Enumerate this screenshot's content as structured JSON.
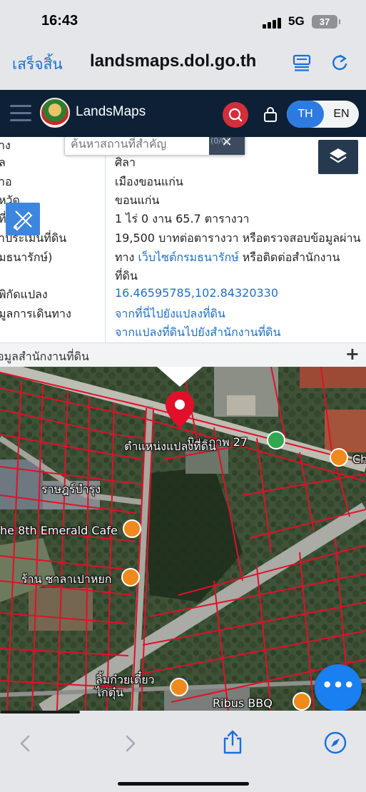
{
  "status_bar": {
    "time": "16:43",
    "network": "5G",
    "battery": "37"
  },
  "browser": {
    "done_label": "เสร็จสิ้น",
    "url": "landsmaps.dol.go.th"
  },
  "header": {
    "brand": "LandsMaps",
    "lang_th": "TH",
    "lang_en": "EN"
  },
  "search": {
    "placeholder": "ค้นหาสถานที่สำคัญ",
    "suffix": "(0/0)"
  },
  "info": {
    "rows": [
      {
        "label": "าง",
        "value": "ศิลา"
      },
      {
        "label": "ล",
        "value": "ศิลา"
      },
      {
        "label": "าอ",
        "value": "เมืองขอนแก่น"
      },
      {
        "label": "หวัด",
        "value": "ขอนแก่น"
      },
      {
        "label": "ที่",
        "value": "1 ไร่ 0 งาน 65.7 ตารางวา"
      },
      {
        "label": "าประเมินที่ดิน",
        "value": "19,500 บาทต่อตารางวา หรือตรวจสอบข้อมูลผ่าน"
      },
      {
        "label": "มธนารักษ์)",
        "value_prefix": "ทาง ",
        "value_link": "เว็บไซต์กรมธนารักษ์",
        "value_suffix": " หรือติดต่อสำนักงาน"
      },
      {
        "label": "",
        "value": "ที่ดิน"
      },
      {
        "label": "พิกัดแปลง",
        "value": "16.46595785,102.84320330"
      },
      {
        "label": "มูลการเดินทาง",
        "value": "จากที่นี่ไปยังแปลงที่ดิน"
      },
      {
        "label": "",
        "value": "จากแปลงที่ดินไปยังสำนักงานที่ดิน"
      }
    ],
    "section_title": "อมูลสำนักงานที่ดิน",
    "section_toggle": "+"
  },
  "map": {
    "labels": {
      "road_north": "มิตรภาพ 27",
      "parcel": "ตำแหน่งแปลงที่ดิน",
      "road_west": "ราษฎร์บำรุง",
      "cafe": "he 8th Emerald Cafe",
      "shop": "ร้าน ซาลาเปาหยก",
      "noodle": "ลิ้มก๋วยเตี๋ยว\nไก่ตุ๋น",
      "bbq": "Ribus BBQ",
      "edge_ch": "Ch"
    },
    "fab_icon": "more-dots-icon"
  },
  "colors": {
    "accent": "#2d7be0",
    "header_bg": "#0d2035",
    "marker": "#e0102a",
    "parcel_line": "#e0102a",
    "link": "#1f6fc5"
  }
}
